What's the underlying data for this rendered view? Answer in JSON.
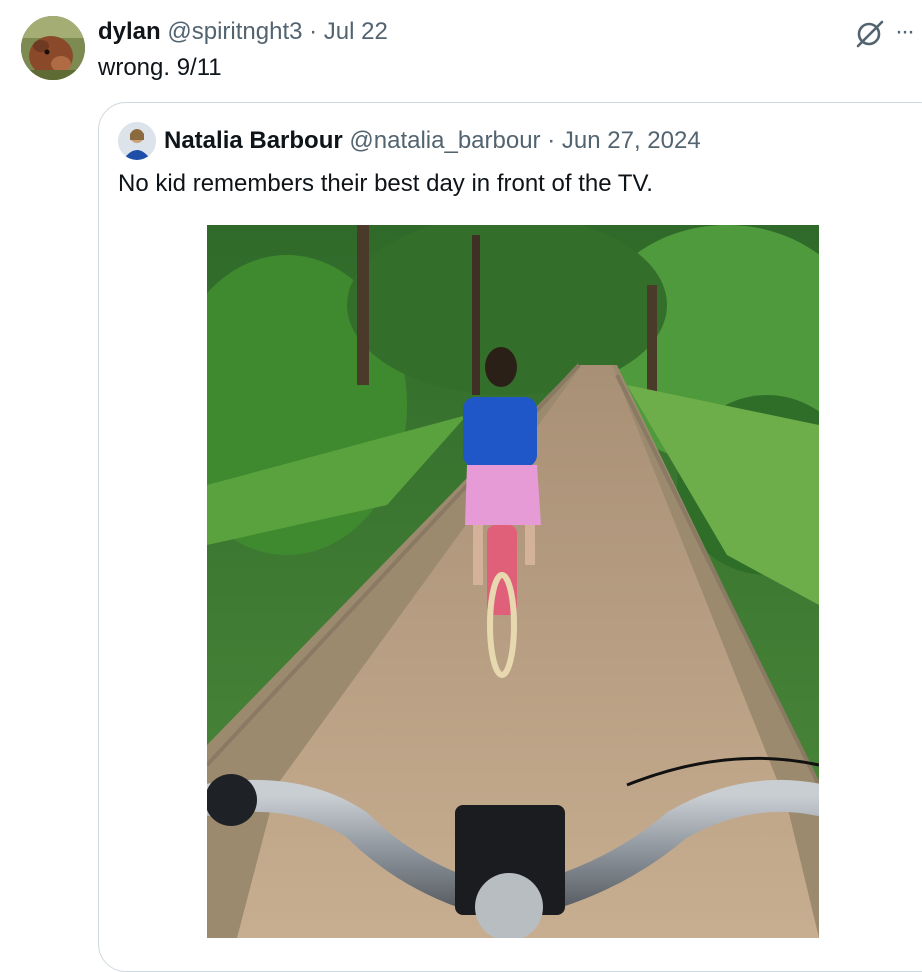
{
  "tweet": {
    "display_name": "dylan",
    "handle": "@spiritnght3",
    "separator": "·",
    "date": "Jul 22",
    "text": "wrong. 9/11",
    "avatar_icon": "cow-avatar",
    "actions": {
      "grok_icon": "grok-icon",
      "more_label": "···"
    }
  },
  "quoted_tweet": {
    "display_name": "Natalia Barbour",
    "handle": "@natalia_barbour",
    "separator": "·",
    "date": "Jun 27, 2024",
    "text": "No kid remembers their best day in front of the TV.",
    "media": "photo of a child riding a pink bicycle on a dirt forest path, seen from behind over bicycle handlebars"
  },
  "colors": {
    "text": "#0f1419",
    "muted": "#536471",
    "border": "#cfd9de"
  }
}
